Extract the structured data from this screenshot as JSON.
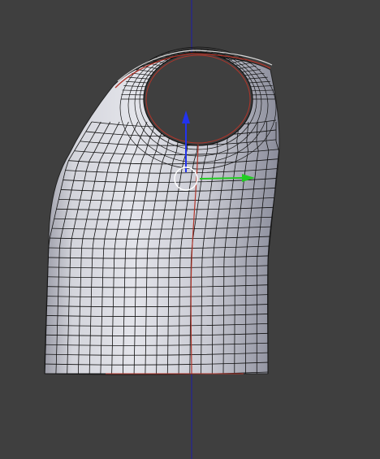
{
  "viewport": {
    "view": "3d-viewport",
    "object": "torso-mesh",
    "display_mode": "solid-wireframe"
  },
  "colors": {
    "background": "#3f3f3f",
    "mesh_fill": "#c3c4cc",
    "mesh_shadow": "#8e8f9c",
    "wire": "#111111",
    "seam": "#b0352a",
    "z_axis": "#1c1ca8",
    "gizmo_y": "#22cc22",
    "gizmo_z": "#2233ee",
    "cursor": "#ffffff"
  },
  "icons": {
    "z_axis_line": "axis-line-icon",
    "gizmo": "transform-gizmo-icon",
    "pivot": "pivot-circle-icon"
  }
}
